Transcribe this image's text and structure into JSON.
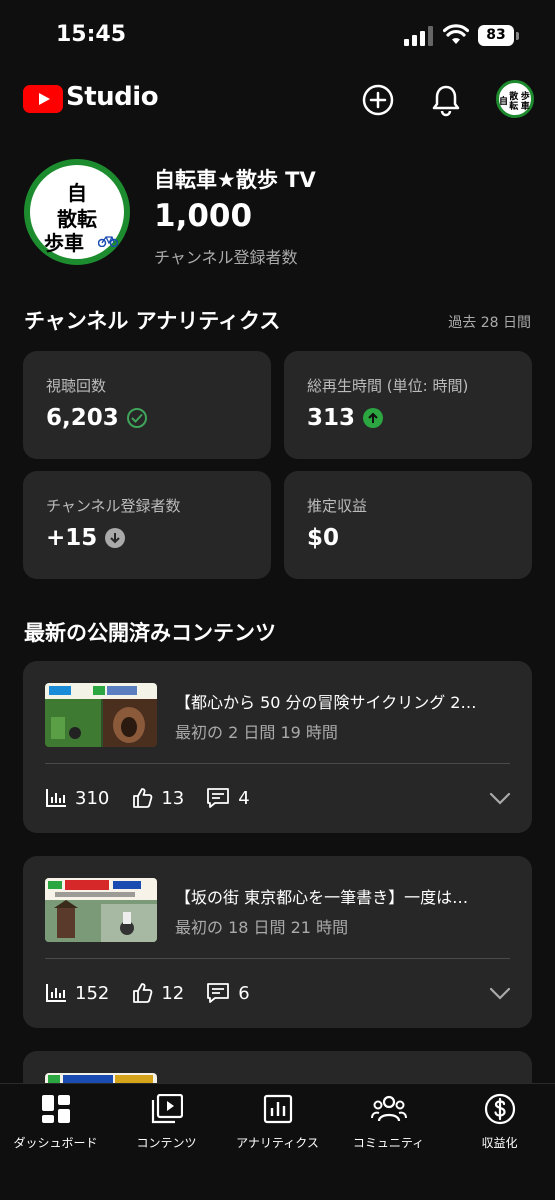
{
  "status_bar": {
    "time": "15:45",
    "battery": "83"
  },
  "header": {
    "app_name": "Studio",
    "avatar_text_1": "自",
    "avatar_text_2": "散転",
    "avatar_text_3": "歩車"
  },
  "channel": {
    "name": "自転車★散歩 TV",
    "subscribers": "1,000",
    "subscribers_label": "チャンネル登録者数",
    "avatar_line1": "自",
    "avatar_line2": "散転",
    "avatar_line3": "歩車"
  },
  "analytics": {
    "title": "チャンネル アナリティクス",
    "period": "過去 28 日間",
    "cards": [
      {
        "label": "視聴回数",
        "value": "6,203",
        "indicator": "check-icon"
      },
      {
        "label": "総再生時間 (単位: 時間)",
        "value": "313",
        "indicator": "arrow-up-icon"
      },
      {
        "label": "チャンネル登録者数",
        "value": "+15",
        "indicator": "arrow-down-icon"
      },
      {
        "label": "推定収益",
        "value": "$0",
        "indicator": ""
      }
    ]
  },
  "latest": {
    "title": "最新の公開済みコンテンツ",
    "videos": [
      {
        "title": "【都心から 50 分の冒険サイクリング 2…",
        "subtitle": "最初の 2 日間 19 時間",
        "views": "310",
        "likes": "13",
        "comments": "4"
      },
      {
        "title": "【坂の街 東京都心を一筆書き】一度は…",
        "subtitle": "最初の 18 日間 21 時間",
        "views": "152",
        "likes": "12",
        "comments": "6"
      }
    ]
  },
  "nav": {
    "items": [
      {
        "label": "ダッシュボード",
        "icon": "dashboard-icon"
      },
      {
        "label": "コンテンツ",
        "icon": "content-icon"
      },
      {
        "label": "アナリティクス",
        "icon": "analytics-icon"
      },
      {
        "label": "コミュニティ",
        "icon": "community-icon"
      },
      {
        "label": "収益化",
        "icon": "monetization-icon"
      }
    ]
  },
  "colors": {
    "background": "#0f0f0f",
    "card": "#272727",
    "brand_red": "#ff0000",
    "up_green": "#2ba640",
    "avatar_green": "#1d8c2f"
  }
}
